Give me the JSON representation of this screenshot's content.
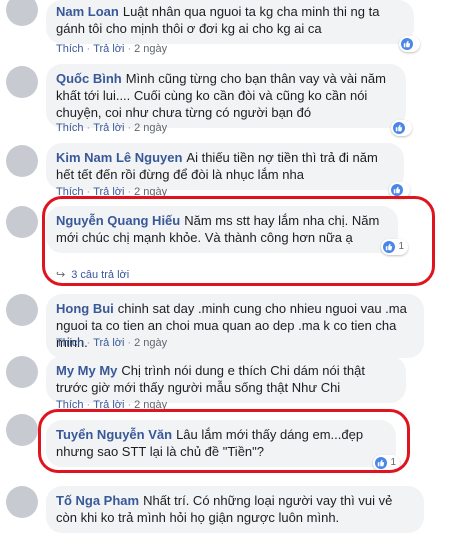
{
  "actions": {
    "like": "Thích",
    "reply": "Trả lời",
    "separator": "·"
  },
  "accent": {
    "author": "#385898",
    "like": "#4a86e8",
    "highlight": "#e0141e"
  },
  "comments": [
    {
      "author": "Nam Loan",
      "text": "Luật nhân qua nguoi ta kg cha minh thi ng ta gánh tôi cho mịnh thôi ơ đơi kg ai cho kg ai ca",
      "time": "2 ngày",
      "likes": ""
    },
    {
      "author": "Quốc Bình",
      "text": "Mình cũng từng cho bạn thân vay và vài năm khất tới lui.... Cuối cùng ko cần đòi và cũng ko cần nói chuyện, coi như chưa từng có người bạn đó",
      "time": "2 ngày",
      "likes": ""
    },
    {
      "author": "Kim Nam Lê Nguyen",
      "text": "Ai thiếu tiền nợ tiền thì trả đi năm hết tết đến rồi đừng để đòi là nhục lắm nha",
      "time": "2 ngày",
      "likes": ""
    },
    {
      "author": "Nguyễn Quang Hiếu",
      "text": "Năm ms stt hay lắm nha chị. Năm mới chúc chị mạnh khỏe. Và thành công hơn nữa ạ",
      "time": "",
      "likes": "1",
      "replies": "3 câu trả lời"
    },
    {
      "author": "Hong Bui",
      "text": "chinh sat day .minh cung cho nhieu nguoi vau .ma nguoi ta co tien an choi mua quan ao dep .ma k co tien cha minh.",
      "time": "2 ngày",
      "likes": ""
    },
    {
      "author": "My My My",
      "text": "Chị trình nói dung e thích Chi dám nói thật trước giờ mới thấy người mẫu sống thật Như Chi",
      "time": "2 ngày",
      "likes": ""
    },
    {
      "author": "Tuyển Nguyễn Văn",
      "text": "Lâu lắm mới thấy dáng em...đẹp nhưng sao STT lại là chủ đề \"Tiền\"?",
      "time": "",
      "likes": "1"
    },
    {
      "author": "Tố Nga Pham",
      "text": "Nhất trí. Có những loại người vay thì vui vẻ còn khi ko trả mình hỏi họ giận ngược luôn mình.",
      "time": "",
      "likes": ""
    }
  ]
}
